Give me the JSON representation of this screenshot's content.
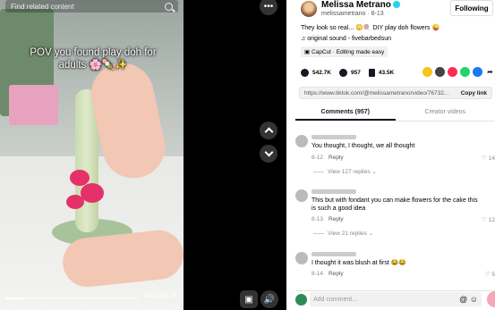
{
  "video": {
    "search_placeholder": "Find related content",
    "caption": "POV you found play doh for adults 🌸🍡✨",
    "progress": 0.14,
    "time": "00:02/00:35"
  },
  "post": {
    "username": "Melissa Metrano",
    "handle": "melissametrano · 8-13",
    "follow_label": "Following",
    "description": "They look so real... 😳🍭 DIY play doh flowers 😜",
    "sound": "original sound - fivebarbedsun",
    "capcut": "CapCut · Editing made easy",
    "likes": "542.7K",
    "comments": "957",
    "saves": "43.5K",
    "url": "https://www.tiktok.com/@melissametrano/video/76732...",
    "copy_label": "Copy link"
  },
  "tabs": [
    "Comments (957)",
    "Creator videos"
  ],
  "comments": [
    {
      "text": "You thought, I thought, we all thought",
      "date": "8-12",
      "reply": "Reply",
      "likes": "14",
      "replies": "View 127 replies ⌄"
    },
    {
      "text": "This but with fondant you can make flowers for the cake this is such a good idea",
      "date": "8-13",
      "reply": "Reply",
      "likes": "12",
      "replies": "View 21 replies ⌄"
    },
    {
      "text": "I thought it was blush at first 😂😂",
      "date": "8-14",
      "reply": "Reply",
      "likes": "5"
    }
  ],
  "input": {
    "placeholder": "Add comment...",
    "icons": "@ ☺"
  },
  "colors": {
    "accent": "#fe2c55",
    "verified": "#20d5ec"
  }
}
